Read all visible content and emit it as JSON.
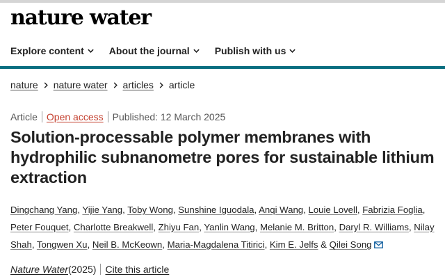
{
  "site": {
    "logo": "nature water"
  },
  "nav": {
    "items": [
      {
        "label": "Explore content"
      },
      {
        "label": "About the journal"
      },
      {
        "label": "Publish with us"
      }
    ]
  },
  "breadcrumb": {
    "items": [
      "nature",
      "nature water",
      "articles"
    ],
    "current": "article"
  },
  "meta": {
    "type": "Article",
    "access": "Open access",
    "published": "Published: 12 March 2025"
  },
  "article": {
    "title": "Solution-processable polymer membranes with hydrophilic subnanometre pores for sustainable lithium extraction",
    "authors": [
      "Dingchang Yang",
      "Yijie Yang",
      "Toby Wong",
      "Sunshine Iguodala",
      "Anqi Wang",
      "Louie Lovell",
      "Fabrizia Foglia",
      "Peter Fouquet",
      "Charlotte Breakwell",
      "Zhiyu Fan",
      "Yanlin Wang",
      "Melanie M. Britton",
      "Daryl R. Williams",
      "Nilay Shah",
      "Tongwen Xu",
      "Neil B. McKeown",
      "Maria-Magdalena Titirici",
      "Kim E. Jelfs",
      "Qilei Song"
    ],
    "author_separator": ", ",
    "last_separator": " & "
  },
  "citation": {
    "journal": "Nature Water",
    "year": " (2025)",
    "cite_label": "Cite this article"
  },
  "colors": {
    "accent": "#0a6e80",
    "open_access": "#c4402f"
  },
  "icons": {
    "nav_chevron": "chevron-down-icon",
    "breadcrumb_sep": "chevron-right-icon",
    "corresponding": "mail-icon"
  }
}
